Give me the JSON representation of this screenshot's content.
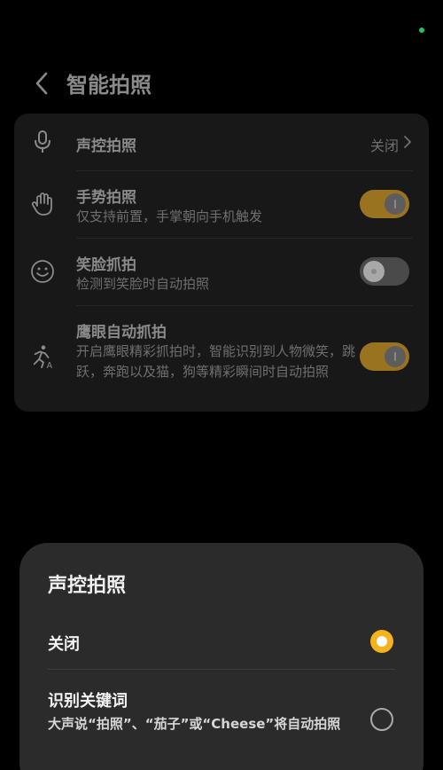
{
  "header": {
    "title": "智能拍照"
  },
  "settings": [
    {
      "label": "声控拍照",
      "value": "关闭",
      "icon": "microphone-icon"
    },
    {
      "label": "手势拍照",
      "sub": "仅支持前置，手掌朝向手机触发",
      "icon": "hand-icon",
      "toggle": "on"
    },
    {
      "label": "笑脸抓拍",
      "sub": "检测到笑脸时自动拍照",
      "icon": "smile-face-icon",
      "toggle": "off"
    },
    {
      "label": "鹰眼自动抓拍",
      "sub": "开启鹰眼精彩抓拍时，智能识别到人物微笑，跳跃，奔跑以及猫，狗等精彩瞬间时自动拍照",
      "icon": "running-person-icon",
      "toggle": "on"
    }
  ],
  "sheet": {
    "title": "声控拍照",
    "options": [
      {
        "label": "关闭",
        "selected": true
      },
      {
        "label": "识别关键词",
        "sub": "大声说“拍照”、“茄子”或“Cheese”将自动拍照",
        "selected": false
      }
    ]
  },
  "colors": {
    "accent": "#f5b21c",
    "toggle_on": "#9a7320",
    "status_dot": "#26c25a"
  }
}
